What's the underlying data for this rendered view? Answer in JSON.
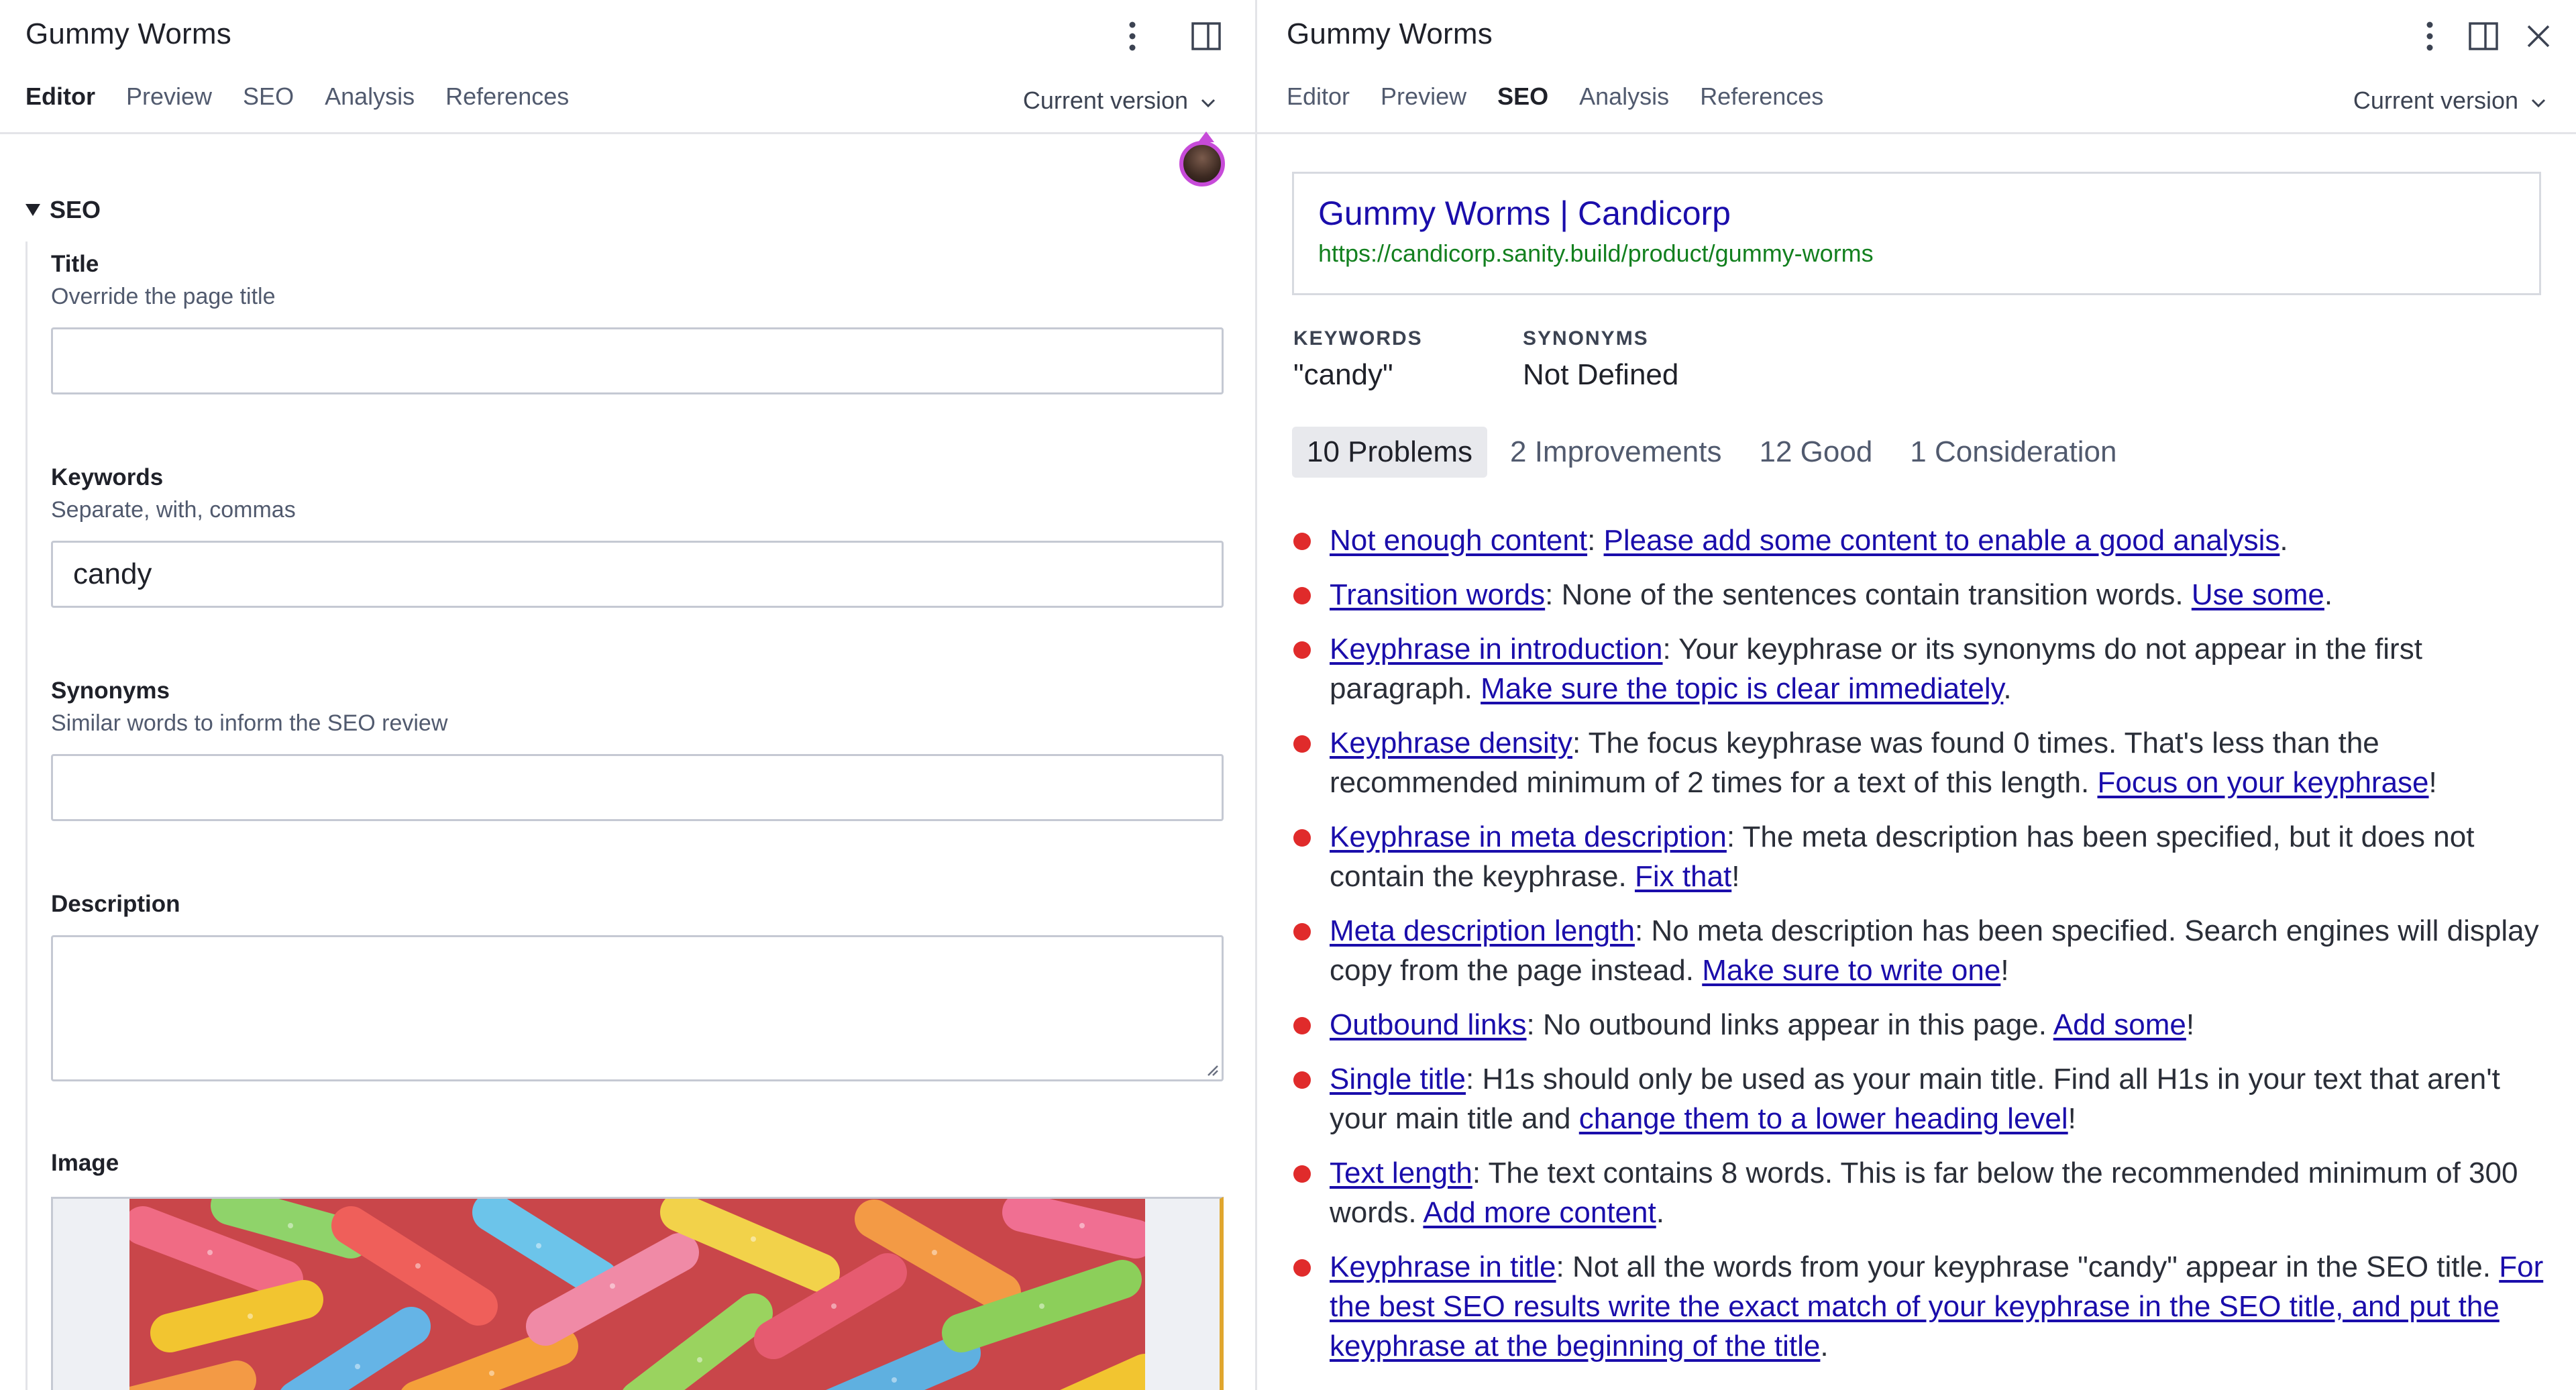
{
  "left_pane": {
    "title": "Gummy Worms",
    "tabs": [
      "Editor",
      "Preview",
      "SEO",
      "Analysis",
      "References"
    ],
    "active_tab": "Editor",
    "version_label": "Current version",
    "fieldset_label": "SEO",
    "fields": {
      "title": {
        "label": "Title",
        "description": "Override the page title",
        "value": ""
      },
      "keywords": {
        "label": "Keywords",
        "description": "Separate, with, commas",
        "value": "candy"
      },
      "synonyms": {
        "label": "Synonyms",
        "description": "Similar words to inform the SEO review",
        "value": ""
      },
      "description": {
        "label": "Description",
        "value": ""
      },
      "image": {
        "label": "Image"
      }
    },
    "icons": [
      "kebab-menu-icon",
      "split-pane-icon",
      "chevron-down-icon",
      "triangle-down-icon"
    ]
  },
  "right_pane": {
    "title": "Gummy Worms",
    "tabs": [
      "Editor",
      "Preview",
      "SEO",
      "Analysis",
      "References"
    ],
    "active_tab": "SEO",
    "version_label": "Current version",
    "icons": [
      "kebab-menu-icon",
      "split-pane-icon",
      "close-icon",
      "chevron-down-icon"
    ],
    "snippet": {
      "title": "Gummy Worms | Candicorp",
      "url": "https://candicorp.sanity.build/product/gummy-worms"
    },
    "keywords_label": "KEYWORDS",
    "keywords_value": "\"candy\"",
    "synonyms_label": "SYNONYMS",
    "synonyms_value": "Not Defined",
    "filters": [
      "10 Problems",
      "2 Improvements",
      "12 Good",
      "1 Consideration"
    ],
    "active_filter": "10 Problems",
    "problems": [
      {
        "link": "Not enough content",
        "text": ": ",
        "action": "Please add some content to enable a good analysis",
        "end": "."
      },
      {
        "link": "Transition words",
        "text": ": None of the sentences contain transition words. ",
        "action": "Use some",
        "end": "."
      },
      {
        "link": "Keyphrase in introduction",
        "text": ": Your keyphrase or its synonyms do not appear in the first paragraph. ",
        "action": "Make sure the topic is clear immediately",
        "end": "."
      },
      {
        "link": "Keyphrase density",
        "text": ": The focus keyphrase was found 0 times. That's less than the recommended minimum of 2 times for a text of this length. ",
        "action": "Focus on your keyphrase",
        "end": "!"
      },
      {
        "link": "Keyphrase in meta description",
        "text": ": The meta description has been specified, but it does not contain the keyphrase. ",
        "action": "Fix that",
        "end": "!"
      },
      {
        "link": "Meta description length",
        "text": ": No meta description has been specified. Search engines will display copy from the page instead. ",
        "action": "Make sure to write one",
        "end": "!"
      },
      {
        "link": "Outbound links",
        "text": ": No outbound links appear in this page. ",
        "action": "Add some",
        "end": "!"
      },
      {
        "link": "Single title",
        "text": ": H1s should only be used as your main title. Find all H1s in your text that aren't your main title and ",
        "action": "change them to a lower heading level",
        "end": "!"
      },
      {
        "link": "Text length",
        "text": ": The text contains 8 words. This is far below the recommended minimum of 300 words. ",
        "action": "Add more content",
        "end": "."
      },
      {
        "link": "Keyphrase in title",
        "text": ": Not all the words from your keyphrase \"candy\" appear in the SEO title. ",
        "action": "For the best SEO results write the exact match of your keyphrase in the SEO title, and put the keyphrase at the beginning of the title",
        "end": "."
      }
    ]
  },
  "colors": {
    "link_blue": "#1a0dab",
    "url_green": "#13801f",
    "problem_red": "#e02b2b",
    "presence_ring": "#c74bd9",
    "image_focus_bar": "#e0a62e"
  }
}
